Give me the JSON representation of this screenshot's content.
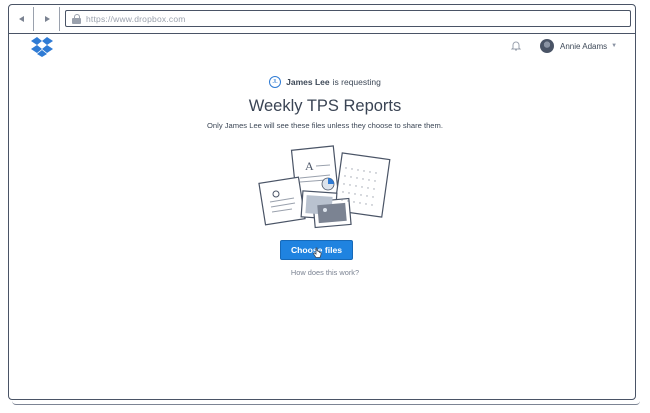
{
  "browser": {
    "url": "https://www.dropbox.com",
    "icons": {
      "back": "arrow-left-icon",
      "forward": "arrow-right-icon",
      "secure": "lock-icon"
    }
  },
  "header": {
    "logo": "dropbox-logo-icon",
    "notifications_icon": "bell-icon",
    "account_name": "Annie Adams",
    "account_menu_icon": "chevron-down-icon"
  },
  "request": {
    "requester_initials": "JL",
    "requester_name": "James Lee",
    "requesting_text": "is requesting",
    "title": "Weekly TPS Reports",
    "subtitle": "Only James Lee will see these files unless they choose to share them.",
    "choose_button_label": "Choose files",
    "help_link": "How does this work?"
  },
  "colors": {
    "accent": "#1f83e0",
    "outline": "#4a5466",
    "text": "#3d4857",
    "muted": "#7b8392"
  }
}
